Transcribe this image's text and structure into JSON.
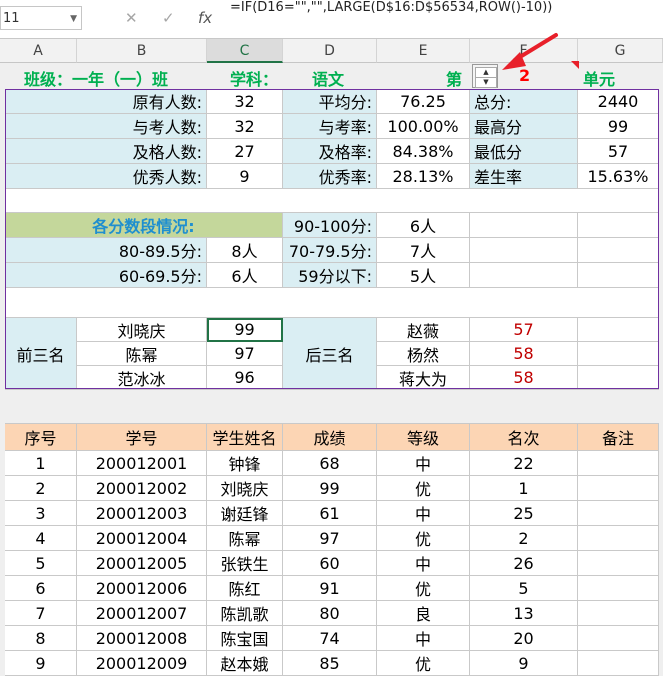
{
  "formula_bar": {
    "name_box": "11",
    "cancel_icon": "✕",
    "enter_icon": "✓",
    "fx_label": "fx",
    "formula": "=IF(D16=\"\",\"\",LARGE(D$16:D$56534,ROW()-10))"
  },
  "columns": [
    "A",
    "B",
    "C",
    "D",
    "E",
    "F",
    "G"
  ],
  "header_row": {
    "class_label": "班级：一年（一）班",
    "subject_label": "学科：",
    "subject_value": "语文",
    "unit_prefix": "第",
    "unit_number": "2",
    "unit_suffix": "单元"
  },
  "summary": [
    {
      "l1": "原有人数:",
      "v1": "32",
      "l2": "平均分:",
      "v2": "76.25",
      "l3": "总分:",
      "v3": "2440"
    },
    {
      "l1": "与考人数:",
      "v1": "32",
      "l2": "与考率:",
      "v2": "100.00%",
      "l3": "最高分",
      "v3": "99"
    },
    {
      "l1": "及格人数:",
      "v1": "27",
      "l2": "及格率:",
      "v2": "84.38%",
      "l3": "最低分",
      "v3": "57"
    },
    {
      "l1": "优秀人数:",
      "v1": "9",
      "l2": "优秀率:",
      "v2": "28.13%",
      "l3": "差生率",
      "v3": "15.63%"
    }
  ],
  "segments": {
    "title": "各分数段情况:",
    "r1": {
      "l2": "90-100分:",
      "v2": "6人"
    },
    "r2": {
      "l1": "80-89.5分:",
      "v1": "8人",
      "l2": "70-79.5分:",
      "v2": "7人"
    },
    "r3": {
      "l1": "60-69.5分:",
      "v1": "6人",
      "l2": "59分以下:",
      "v2": "5人"
    }
  },
  "top_three": {
    "label": "前三名",
    "rows": [
      {
        "name": "刘晓庆",
        "score": "99"
      },
      {
        "name": "陈幂",
        "score": "97"
      },
      {
        "name": "范冰冰",
        "score": "96"
      }
    ]
  },
  "bottom_three": {
    "label": "后三名",
    "rows": [
      {
        "name": "赵薇",
        "score": "57"
      },
      {
        "name": "杨然",
        "score": "58"
      },
      {
        "name": "蒋大为",
        "score": "58"
      }
    ]
  },
  "table": {
    "headers": [
      "序号",
      "学号",
      "学生姓名",
      "成绩",
      "等级",
      "名次",
      "备注"
    ],
    "rows": [
      [
        "1",
        "200012001",
        "钟锋",
        "68",
        "中",
        "22",
        ""
      ],
      [
        "2",
        "200012002",
        "刘晓庆",
        "99",
        "优",
        "1",
        ""
      ],
      [
        "3",
        "200012003",
        "谢廷锋",
        "61",
        "中",
        "25",
        ""
      ],
      [
        "4",
        "200012004",
        "陈幂",
        "97",
        "优",
        "2",
        ""
      ],
      [
        "5",
        "200012005",
        "张铁生",
        "60",
        "中",
        "26",
        ""
      ],
      [
        "6",
        "200012006",
        "陈红",
        "91",
        "优",
        "5",
        ""
      ],
      [
        "7",
        "200012007",
        "陈凯歌",
        "80",
        "良",
        "13",
        ""
      ],
      [
        "8",
        "200012008",
        "陈宝国",
        "74",
        "中",
        "20",
        ""
      ],
      [
        "9",
        "200012009",
        "赵本娥",
        "85",
        "优",
        "9",
        ""
      ]
    ]
  }
}
